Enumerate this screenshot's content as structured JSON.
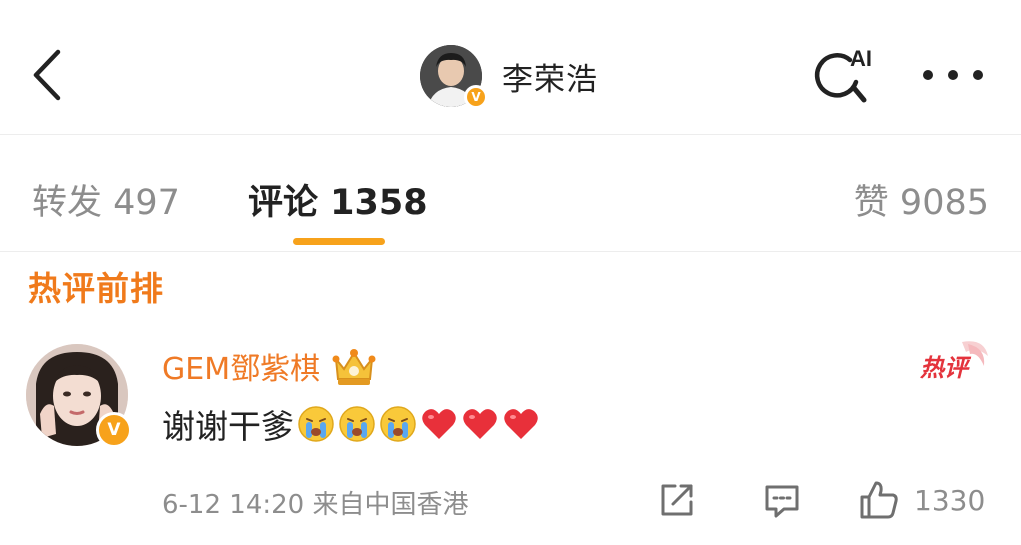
{
  "header": {
    "profile_name": "李荣浩",
    "verified_mark": "V",
    "ai_label": "AI",
    "icons": [
      "back-arrow-icon",
      "ai-search-icon",
      "more-dots-icon"
    ]
  },
  "tabs": {
    "repost": "转发 497",
    "comments": "评论 1358",
    "likes": "赞 9085",
    "active": "comments"
  },
  "section": {
    "title": "热评前排"
  },
  "comment": {
    "username": "GEM鄧紫棋",
    "verified_mark": "V",
    "text": "谢谢干爹",
    "emojis": [
      "crying-face-icon",
      "crying-face-icon",
      "crying-face-icon",
      "red-heart-icon",
      "red-heart-icon",
      "red-heart-icon"
    ],
    "hot_tag": "热评",
    "meta": "6-12 14:20 来自中国香港",
    "like_count": "1330"
  },
  "colors": {
    "accent": "#f7a21b",
    "username": "#ef7a26",
    "section_title": "#f07a1b",
    "muted": "#8d8d8d",
    "hot_tag": "#e4333c"
  }
}
